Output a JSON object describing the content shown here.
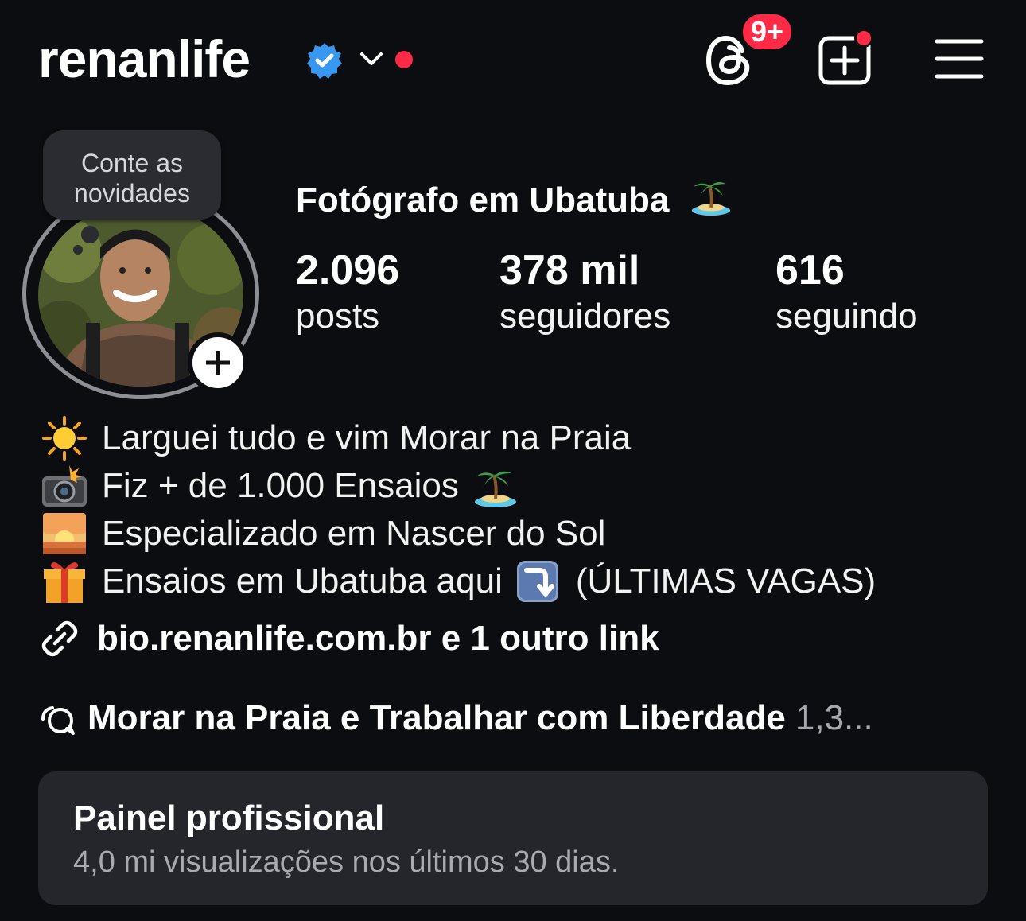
{
  "header": {
    "username": "renanlife",
    "threads_badge": "9+"
  },
  "note": {
    "line1": "Conte as",
    "line2": "novidades"
  },
  "profile": {
    "display_name": "Fotógrafo em Ubatuba"
  },
  "stats": [
    {
      "value": "2.096",
      "label": "posts"
    },
    {
      "value": "378 mil",
      "label": "seguidores"
    },
    {
      "value": "616",
      "label": "seguindo"
    }
  ],
  "bio": {
    "line1": "Larguei tudo e vim Morar na Praia",
    "line2": "Fiz + de 1.000 Ensaios",
    "line3": "Especializado em Nascer do Sol",
    "line4_a": "Ensaios em Ubatuba aqui",
    "line4_b": "(ÚLTIMAS VAGAS)"
  },
  "link": {
    "text": "bio.renanlife.com.br e 1 outro link"
  },
  "channel": {
    "name": "Morar na Praia e Trabalhar com Liberdade",
    "count": "1,3..."
  },
  "panel": {
    "title": "Painel profissional",
    "subtitle": "4,0 mi visualizações nos últimos 30 dias."
  },
  "colors": {
    "background": "#0c0d10",
    "badge_red": "#ff2a46",
    "verified_blue": "#3897f0",
    "panel_bg": "#25262b"
  },
  "icons": [
    "verified-badge-icon",
    "chevron-down-icon",
    "threads-icon",
    "create-post-icon",
    "menu-icon",
    "sun-emoji",
    "camera-flash-emoji",
    "sunrise-emoji",
    "gift-emoji",
    "island-emoji",
    "arrow-down-right-emoji",
    "link-icon",
    "broadcast-channel-icon"
  ]
}
